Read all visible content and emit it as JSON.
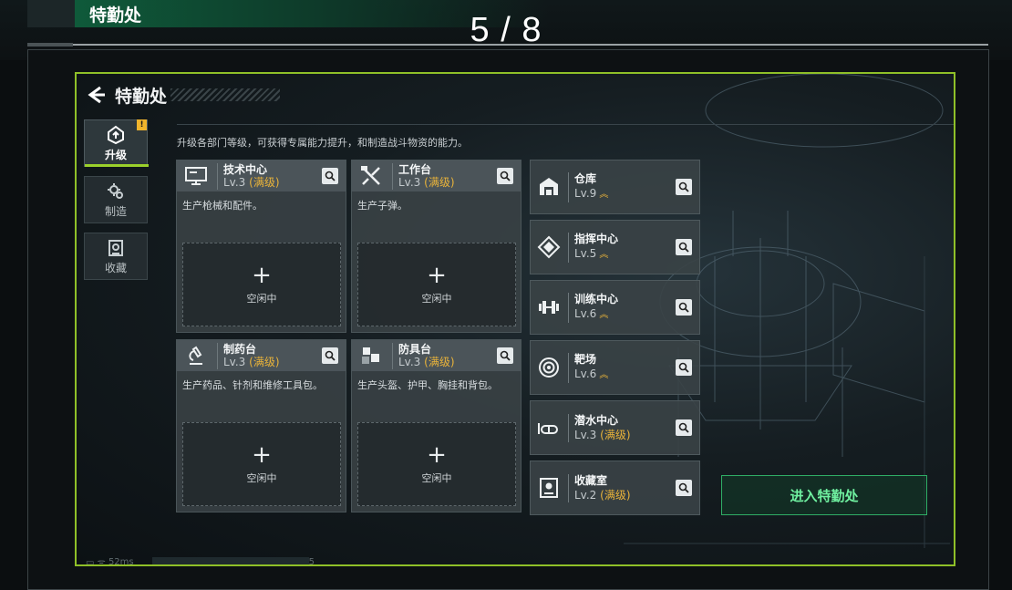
{
  "banner": {
    "title": "特勤处",
    "page_indicator": "5 / 8"
  },
  "screen": {
    "header": {
      "title": "特勤处"
    },
    "tabs": [
      {
        "label": "升级",
        "icon": "upgrade-icon",
        "active": true,
        "badge": "!"
      },
      {
        "label": "制造",
        "icon": "gears-icon",
        "active": false
      },
      {
        "label": "收藏",
        "icon": "collection-icon",
        "active": false
      }
    ],
    "description": "升级各部门等级，可获得专属能力提升，和制造战斗物资的能力。",
    "workshops": [
      {
        "name": "技术中心",
        "level": "Lv.3",
        "max": "(满级)",
        "desc": "生产枪械和配件。",
        "slot_plus": "+",
        "slot_label": "空闲中",
        "icon": "computer-icon"
      },
      {
        "name": "工作台",
        "level": "Lv.3",
        "max": "(满级)",
        "desc": "生产子弹。",
        "slot_plus": "+",
        "slot_label": "空闲中",
        "icon": "tools-icon"
      },
      {
        "name": "制药台",
        "level": "Lv.3",
        "max": "(满级)",
        "desc": "生产药品、针剂和维修工具包。",
        "slot_plus": "+",
        "slot_label": "空闲中",
        "icon": "microscope-icon"
      },
      {
        "name": "防具台",
        "level": "Lv.3",
        "max": "(满级)",
        "desc": "生产头盔、护甲、胸挂和背包。",
        "slot_plus": "+",
        "slot_label": "空闲中",
        "icon": "armor-icon"
      }
    ],
    "facilities": [
      {
        "name": "仓库",
        "level": "Lv.9",
        "max": "",
        "upgrade": true,
        "icon": "warehouse-icon"
      },
      {
        "name": "指挥中心",
        "level": "Lv.5",
        "max": "",
        "upgrade": true,
        "icon": "command-icon"
      },
      {
        "name": "训练中心",
        "level": "Lv.6",
        "max": "",
        "upgrade": true,
        "icon": "dumbbell-icon"
      },
      {
        "name": "靶场",
        "level": "Lv.6",
        "max": "",
        "upgrade": true,
        "icon": "target-icon"
      },
      {
        "name": "潜水中心",
        "level": "Lv.3",
        "max": "(满级)",
        "upgrade": false,
        "icon": "diving-icon"
      },
      {
        "name": "收藏室",
        "level": "Lv.2",
        "max": "(满级)",
        "upgrade": false,
        "icon": "collection-room-icon"
      }
    ],
    "enter_button": "进入特勤处",
    "status": {
      "ping": "52ms",
      "extra": "5"
    },
    "colors": {
      "accent_green": "#8fc028",
      "gold": "#e9b33a",
      "enter_green": "#6ff0a0"
    }
  }
}
